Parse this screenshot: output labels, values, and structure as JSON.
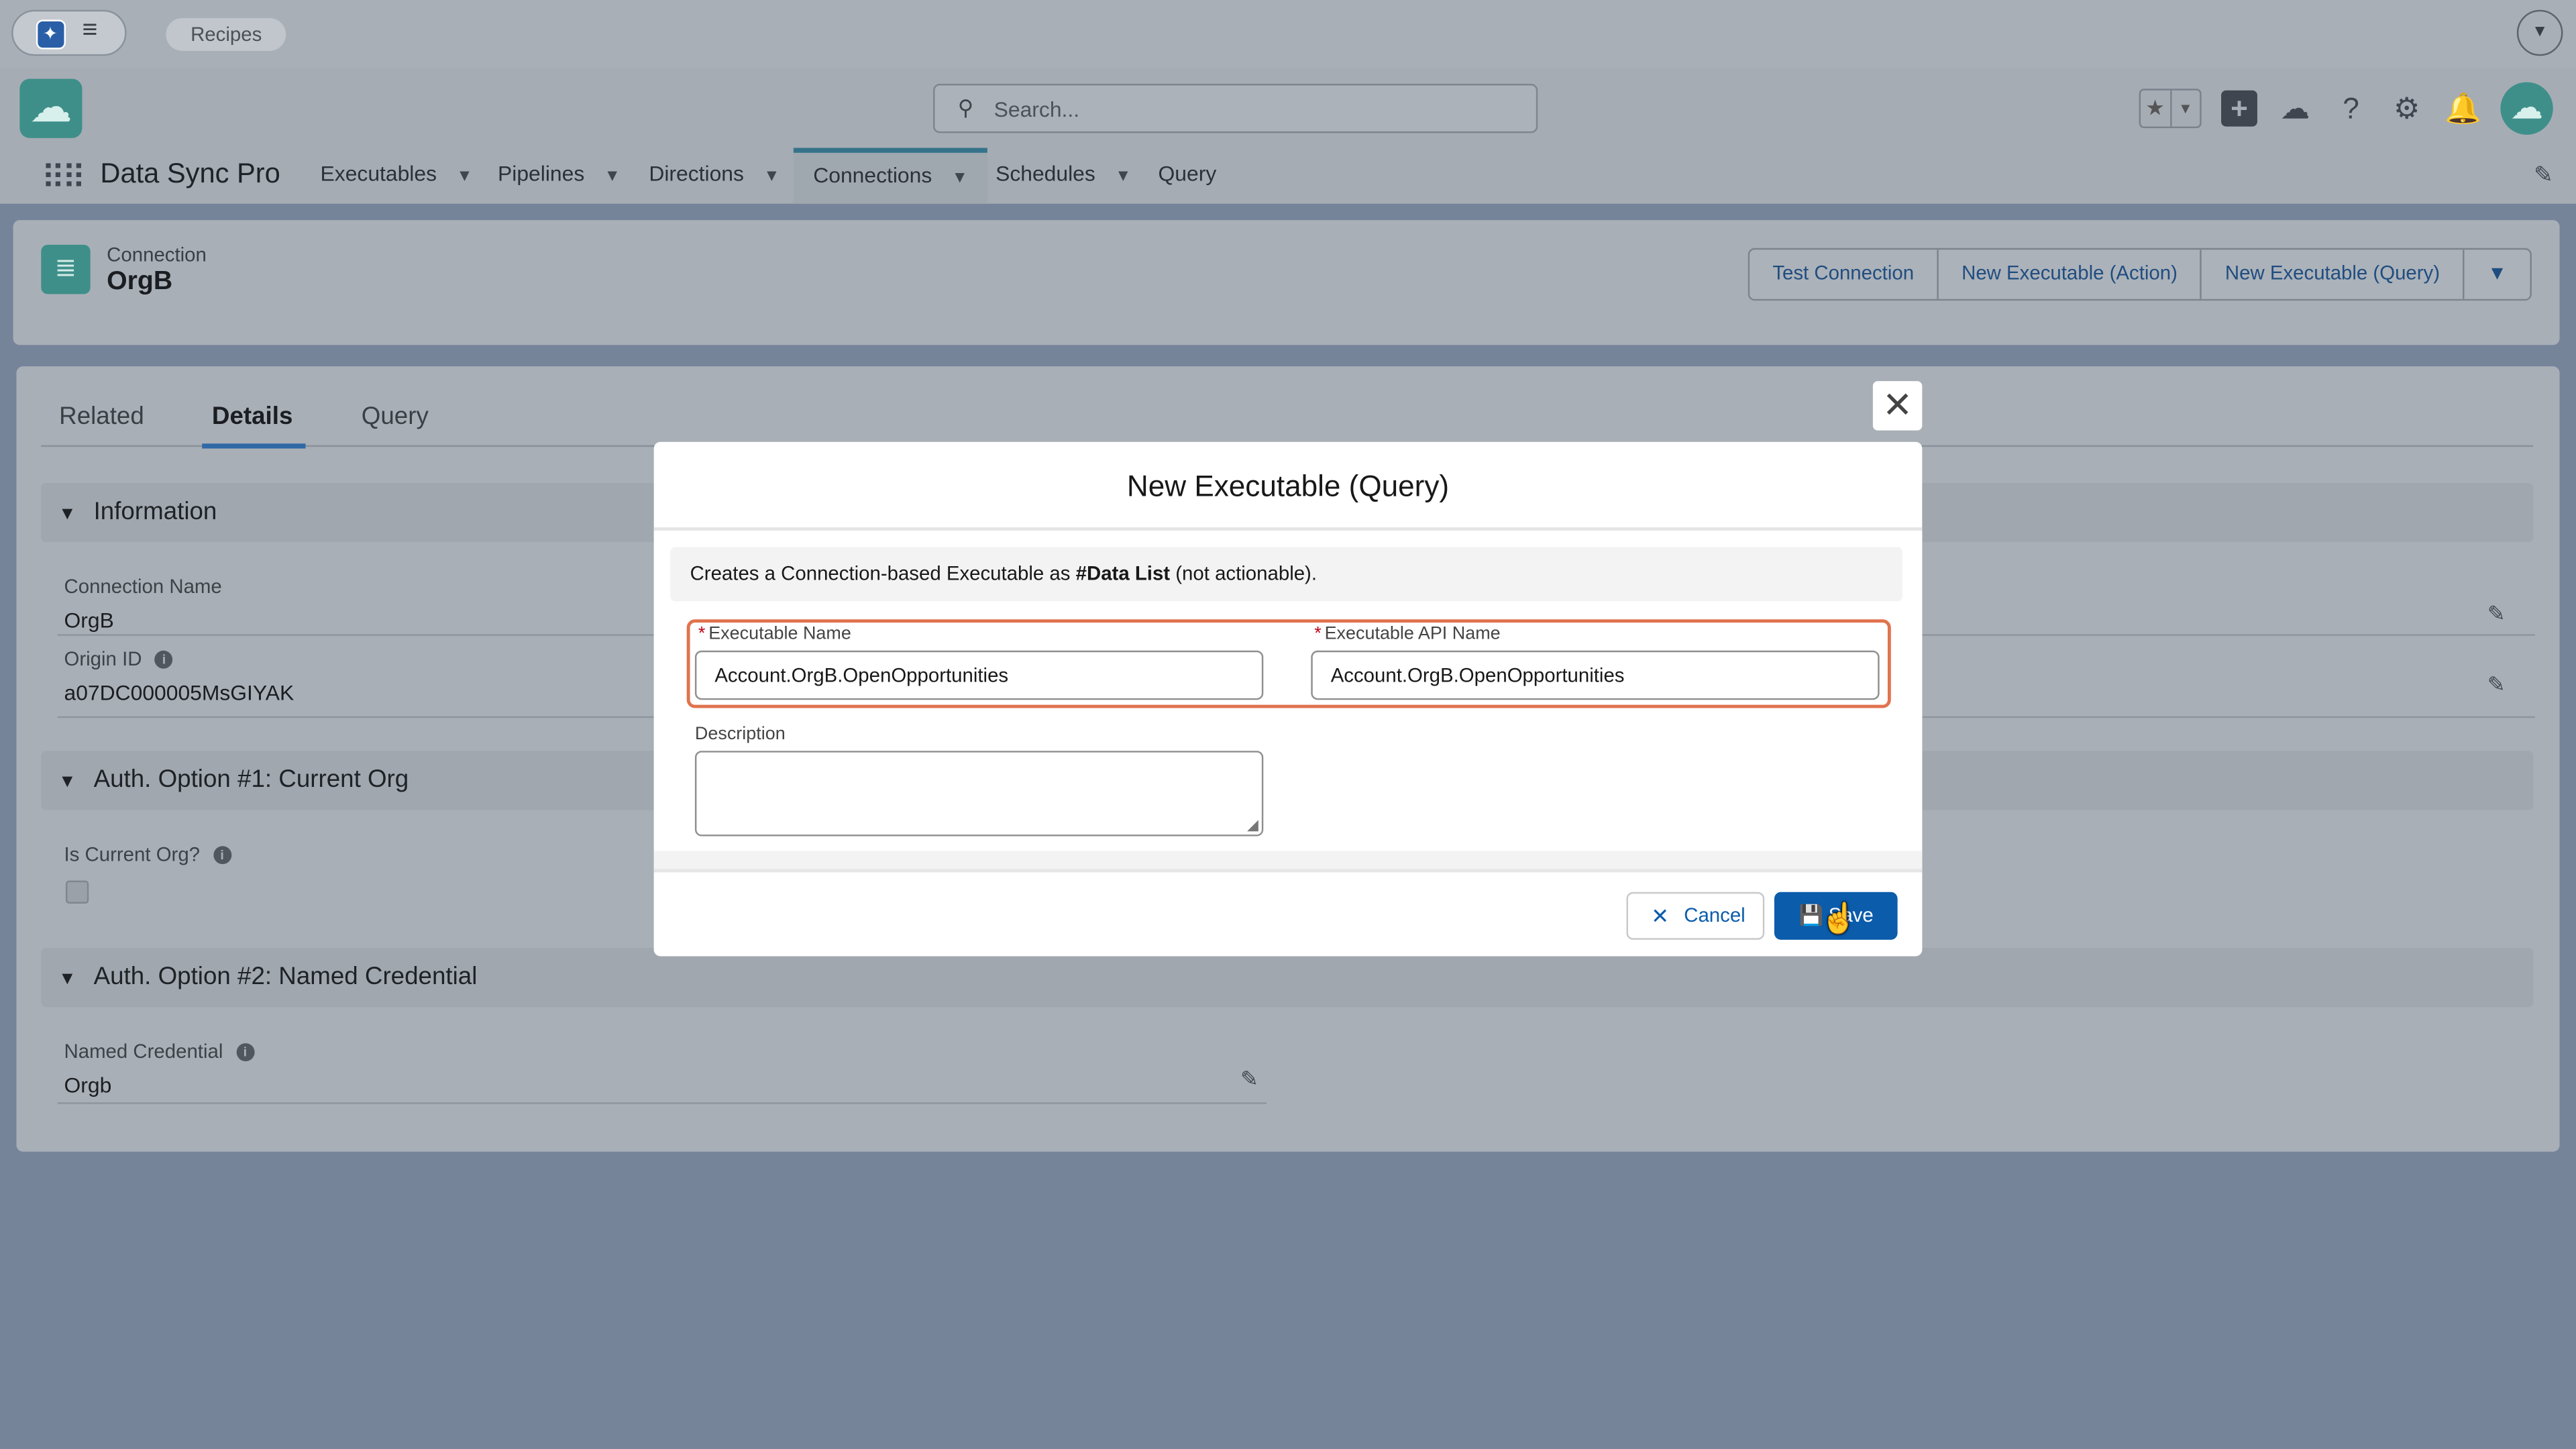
{
  "topbar": {
    "recipes_chip": "Recipes",
    "menu_icon": "hamburger-icon",
    "dropdown_icon": "chevron-down-icon"
  },
  "header": {
    "search_placeholder": "Search...",
    "app_name": "Data Sync Pro",
    "nav_items": [
      {
        "label": "Executables",
        "active": false
      },
      {
        "label": "Pipelines",
        "active": false
      },
      {
        "label": "Directions",
        "active": false
      },
      {
        "label": "Connections",
        "active": true
      },
      {
        "label": "Schedules",
        "active": false
      },
      {
        "label": "Query",
        "active": false
      }
    ],
    "icons": [
      "favorites-icon",
      "add-icon",
      "trailhead-icon",
      "help-icon",
      "setup-gear-icon",
      "notifications-bell-icon",
      "user-avatar"
    ]
  },
  "record": {
    "object_label": "Connection",
    "name": "OrgB",
    "actions": [
      "Test Connection",
      "New Executable (Action)",
      "New Executable (Query)"
    ]
  },
  "tabs": [
    "Related",
    "Details",
    "Query"
  ],
  "selected_tab": "Details",
  "sections": {
    "information": {
      "title": "Information",
      "connection_name_label": "Connection Name",
      "connection_name_value": "OrgB",
      "origin_id_label": "Origin ID",
      "origin_id_value": "a07DC000005MsGIYAK"
    },
    "auth1": {
      "title": "Auth. Option #1: Current Org",
      "is_current_org_label": "Is Current Org?",
      "is_current_org_checked": false
    },
    "auth2": {
      "title": "Auth. Option #2: Named Credential",
      "named_credential_label": "Named Credential",
      "named_credential_value": "Orgb"
    }
  },
  "modal": {
    "title": "New Executable (Query)",
    "info_prefix": "Creates a Connection-based Executable as ",
    "info_bold": "#Data List",
    "info_suffix": " (not actionable).",
    "required_marker": "*",
    "exec_name_label": "Executable Name",
    "exec_name_value": "Account.OrgB.OpenOpportunities",
    "exec_api_label": "Executable API Name",
    "exec_api_value": "Account.OrgB.OpenOpportunities",
    "description_label": "Description",
    "description_value": "",
    "cancel_label": "Cancel",
    "save_label": "Save",
    "highlight_color": "#e0734e",
    "brand_color": "#0b5cab"
  }
}
